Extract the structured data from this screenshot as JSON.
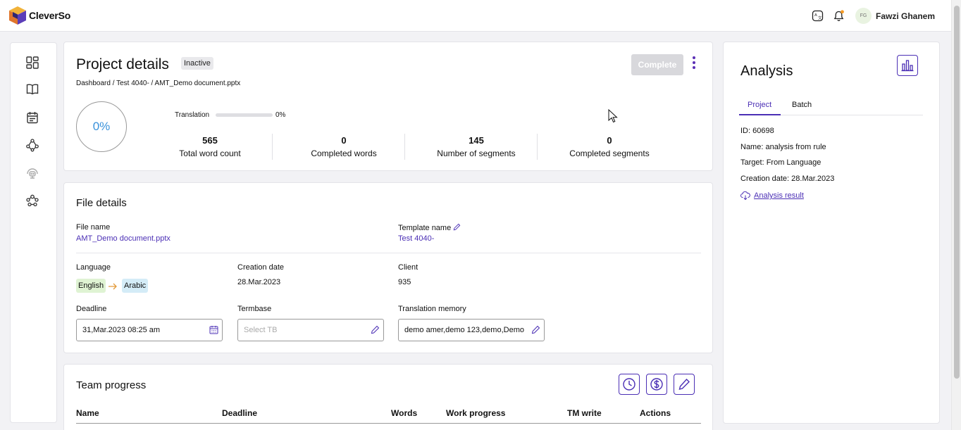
{
  "app": {
    "name": "CleverSo"
  },
  "user": {
    "initials": "FG",
    "name": "Fawzi Ghanem"
  },
  "icons": {
    "header": [
      "translate-icon",
      "bell-icon"
    ],
    "rail": [
      "dashboard-icon",
      "book-icon",
      "calendar-icon",
      "network-icon",
      "robot-icon",
      "team-icon"
    ]
  },
  "colors": {
    "accent": "#4b2fb5",
    "progress_text": "#3a92db",
    "english_chip": "#dff3d3",
    "arabic_chip": "#d4ecf7",
    "notification_dot": "#f59a23"
  },
  "project": {
    "title": "Project details",
    "status": "Inactive",
    "complete_label": "Complete",
    "breadcrumb": "Dashboard / Test 4040- / AMT_Demo document.pptx",
    "overall_progress": "0%",
    "translation_label": "Translation",
    "translation_progress": "0%",
    "translation_progress_value": 0,
    "stats": [
      {
        "value": "565",
        "label": "Total word count"
      },
      {
        "value": "0",
        "label": "Completed words"
      },
      {
        "value": "145",
        "label": "Number of segments"
      },
      {
        "value": "0",
        "label": "Completed segments"
      }
    ]
  },
  "file": {
    "title": "File details",
    "file_name_label": "File name",
    "file_name": "AMT_Demo document.pptx",
    "template_label": "Template name",
    "template_name": "Test 4040-",
    "language_label": "Language",
    "source_language": "English",
    "target_language": "Arabic",
    "creation_label": "Creation date",
    "creation_date": "28.Mar.2023",
    "client_label": "Client",
    "client": "935",
    "deadline_label": "Deadline",
    "deadline_value": "31,Mar.2023 08:25 am",
    "termbase_label": "Termbase",
    "termbase_placeholder": "Select TB",
    "tm_label": "Translation memory",
    "tm_value": "demo amer,demo 123,demo,Demo"
  },
  "team": {
    "title": "Team progress",
    "columns": [
      "Name",
      "Deadline",
      "Words",
      "Work progress",
      "TM write",
      "Actions"
    ]
  },
  "analysis": {
    "title": "Analysis",
    "tabs": [
      "Project",
      "Batch"
    ],
    "id_label": "ID:",
    "id": "60698",
    "name_label": "Name:",
    "name": "analysis from rule",
    "target_label": "Target:",
    "target": "From Language",
    "creation_label": "Creation date:",
    "creation_date": "28.Mar.2023",
    "result_link": "Analysis result"
  }
}
